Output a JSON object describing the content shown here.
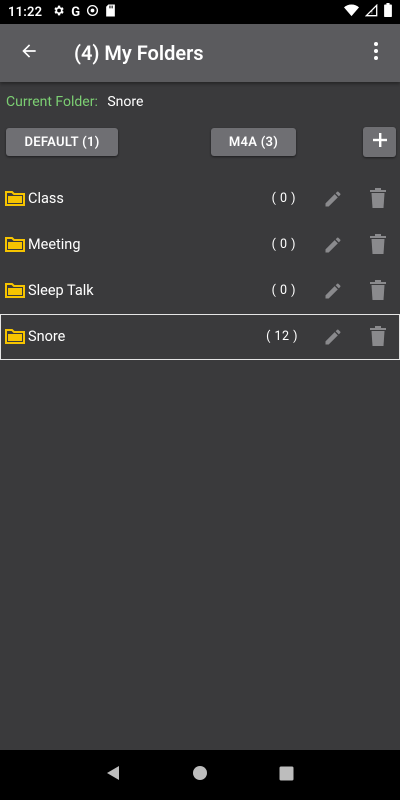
{
  "status_bar": {
    "time": "11:22",
    "left_icons": [
      "gear-icon",
      "google-icon",
      "vpn-icon",
      "sd-card-icon"
    ],
    "right_icons": [
      "wifi-icon",
      "signal-icon",
      "battery-icon"
    ]
  },
  "app_bar": {
    "title": "(4) My Folders",
    "back_icon": "arrow-left-icon",
    "menu_icon": "more-vertical-icon"
  },
  "current_folder": {
    "label": "Current Folder:",
    "value": "Snore"
  },
  "toolbar": {
    "default_label": "DEFAULT (1)",
    "m4a_label": "M4A (3)",
    "add_label": "+"
  },
  "folders": [
    {
      "name": "Class",
      "count": "( 0 )",
      "selected": false
    },
    {
      "name": "Meeting",
      "count": "( 0 )",
      "selected": false
    },
    {
      "name": "Sleep Talk",
      "count": "( 0 )",
      "selected": false
    },
    {
      "name": "Snore",
      "count": "( 12 )",
      "selected": true
    }
  ],
  "colors": {
    "background": "#3a3a3c",
    "app_bar": "#5b5b5e",
    "accent_green": "#7ccf73",
    "folder_yellow": "#f6c400",
    "button_gray": "#6f6f73",
    "icon_gray": "#8a8a8d"
  }
}
